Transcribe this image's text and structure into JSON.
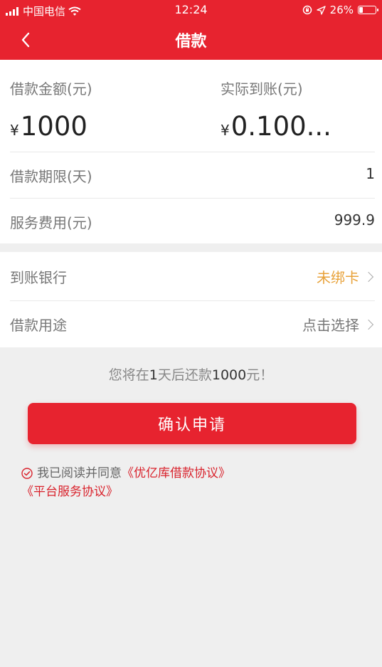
{
  "status_bar": {
    "carrier": "中国电信",
    "time": "12:24",
    "battery": "26%",
    "battery_level": 0.26
  },
  "nav": {
    "title": "借款"
  },
  "loan": {
    "amount_label": "借款金额(元)",
    "amount_value": "1000",
    "received_label": "实际到账(元)",
    "received_value": "0.100...",
    "currency": "¥",
    "term_label": "借款期限(天)",
    "term_value": "1",
    "fee_label": "服务费用(元)",
    "fee_value": "999.9"
  },
  "options": {
    "bank_label": "到账银行",
    "bank_value": "未绑卡",
    "purpose_label": "借款用途",
    "purpose_value": "点击选择"
  },
  "notice": {
    "prefix": "您将在",
    "days": "1",
    "middle": "天后还款",
    "amount": "1000",
    "suffix": "元！"
  },
  "confirm_label": "确认申请",
  "agreement": {
    "prefix": "我已阅读并同意",
    "link1": "《优亿库借款协议》",
    "link2": "《平台服务协议》"
  },
  "colors": {
    "brand": "#e7232f",
    "warning": "#e8a23a",
    "link": "#d9222c"
  }
}
